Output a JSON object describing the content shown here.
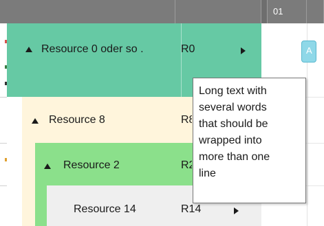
{
  "header": {
    "column_3_label": "01"
  },
  "rows": [
    {
      "name": "Resource 0 oder so , R0 ellipsis",
      "label": "Resource 0 oder so .",
      "code": "R0"
    },
    {
      "label": "Resource 8",
      "code": "R8"
    },
    {
      "label": "Resource 2",
      "code": "R2"
    },
    {
      "label": "Resource 14",
      "code": "R14"
    }
  ],
  "gantt": {
    "task_label": "A"
  },
  "tooltip": {
    "text": "Long text with\nseveral words\nthat should be\nwrapped into\nmore than one\nline"
  },
  "colors": {
    "header": "#7b7b7b",
    "level0": "#66c9a4",
    "level1": "#fff5dc",
    "level2": "#8be08b",
    "level3": "#efefef",
    "task": "#8fd8e8"
  },
  "icons": {
    "expand": "triangle-expanded-icon",
    "navigate": "play-arrow-icon"
  }
}
